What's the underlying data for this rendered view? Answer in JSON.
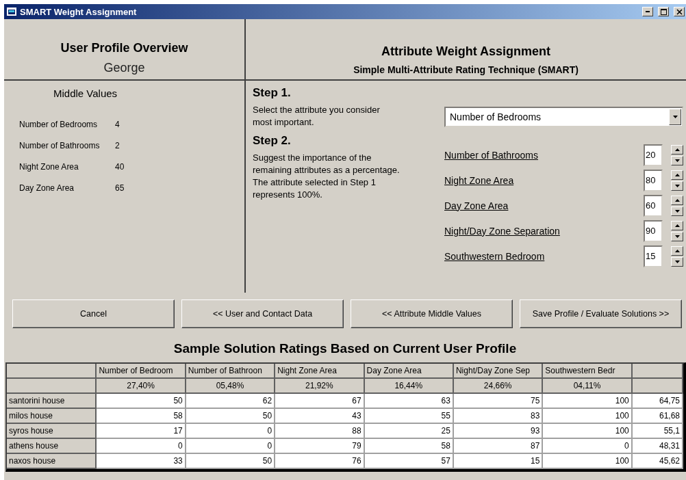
{
  "window": {
    "title": "SMART Weight Assignment"
  },
  "profile": {
    "heading": "User Profile Overview",
    "user": "George",
    "middle_values_heading": "Middle Values",
    "middle_values": [
      {
        "label": "Number of Bedrooms",
        "value": "4"
      },
      {
        "label": "Number of Bathrooms",
        "value": "2"
      },
      {
        "label": "Night Zone Area",
        "value": "40"
      },
      {
        "label": "Day Zone Area",
        "value": "65"
      }
    ]
  },
  "weights": {
    "heading": "Attribute Weight Assignment",
    "subheading": "Simple Multi-Attribute Rating Technique (SMART)",
    "steps": [
      {
        "title": "Step 1.",
        "text": "Select the attribute you consider most important."
      },
      {
        "title": "Step 2.",
        "text": "Suggest the importance of the remaining attributes as a percentage. The attribute selected in Step 1 represents 100%."
      }
    ],
    "dropdown": {
      "value": "Number of Bedrooms"
    },
    "attributes": [
      {
        "label": "Number of Bathrooms",
        "value": "20"
      },
      {
        "label": "Night Zone Area",
        "value": "80"
      },
      {
        "label": "Day Zone Area",
        "value": "60"
      },
      {
        "label": "Night/Day Zone Separation",
        "value": "90"
      },
      {
        "label": "Southwestern Bedroom",
        "value": "15"
      }
    ]
  },
  "buttons": [
    "Cancel",
    "<< User and Contact Data",
    "<< Attribute Middle Values",
    "Save Profile / Evaluate Solutions >>"
  ],
  "table": {
    "title": "Sample Solution Ratings Based on Current User Profile",
    "columns": [
      "Number of Bedroom",
      "Number of Bathroon",
      "Night Zone Area",
      "Day Zone Area",
      "Night/Day Zone Sep",
      "Southwestern Bedr"
    ],
    "weights": [
      "27,40%",
      "05,48%",
      "21,92%",
      "16,44%",
      "24,66%",
      "04,11%"
    ],
    "rows": [
      {
        "name": "santorini house",
        "values": [
          "50",
          "62",
          "67",
          "63",
          "75",
          "100"
        ],
        "column_8": "64,75"
      },
      {
        "name": "milos house",
        "values": [
          "58",
          "50",
          "43",
          "55",
          "83",
          "100"
        ],
        "column_8": "61,68"
      },
      {
        "name": "syros house",
        "values": [
          "17",
          "0",
          "88",
          "25",
          "93",
          "100"
        ],
        "column_8": "55,1"
      },
      {
        "name": "athens house",
        "values": [
          "0",
          "0",
          "79",
          "58",
          "87",
          "0"
        ],
        "column_8": "48,31"
      },
      {
        "name": "naxos house",
        "values": [
          "33",
          "50",
          "76",
          "57",
          "15",
          "100"
        ],
        "column_8": "45,62"
      }
    ]
  }
}
